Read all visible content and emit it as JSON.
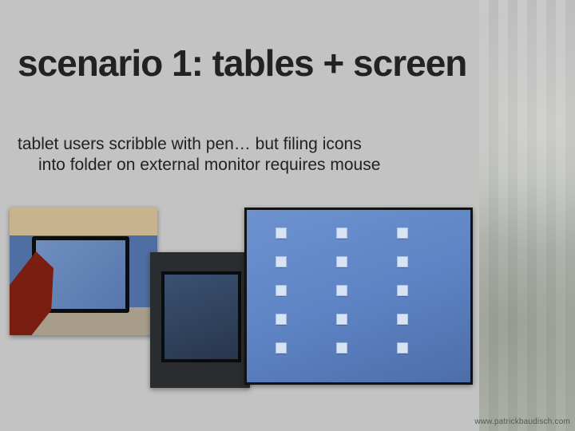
{
  "title": "scenario 1: tables + screen",
  "body": {
    "line1": "tablet users scribble with pen… but filing icons",
    "line2": "into folder on external monitor requires mouse"
  },
  "images": {
    "photo1_alt": "person using stylus on tablet PC",
    "photo2_alt": "close-up of tablet and stylus",
    "photo3_alt": "external monitor showing desktop icons"
  },
  "footer_url": "www.patrickbaudisch.com"
}
